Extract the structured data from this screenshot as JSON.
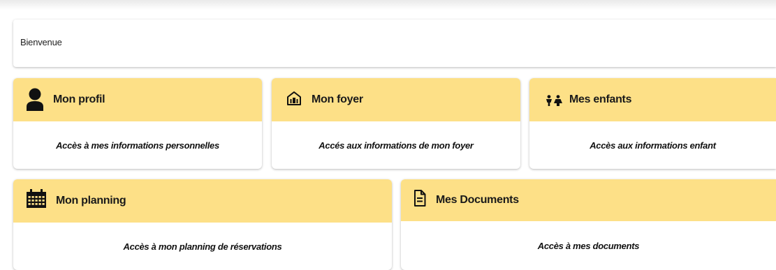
{
  "welcome": {
    "text": "Bienvenue"
  },
  "cards": [
    {
      "title": "Mon profil",
      "description": "Accès à mes informations personnelles",
      "icon": "person-icon"
    },
    {
      "title": "Mon foyer",
      "description": "Accés aux informations de mon foyer",
      "icon": "home-icon"
    },
    {
      "title": "Mes enfants",
      "description": "Accès aux informations enfant",
      "icon": "children-icon"
    },
    {
      "title": "Mon planning",
      "description": "Accès à mon planning de réservations",
      "icon": "calendar-icon"
    },
    {
      "title": "Mes Documents",
      "description": "Accès à mes documents",
      "icon": "document-icon"
    }
  ],
  "colors": {
    "card_header": "#fde087",
    "card_body": "#ffffff",
    "text": "#111111"
  }
}
